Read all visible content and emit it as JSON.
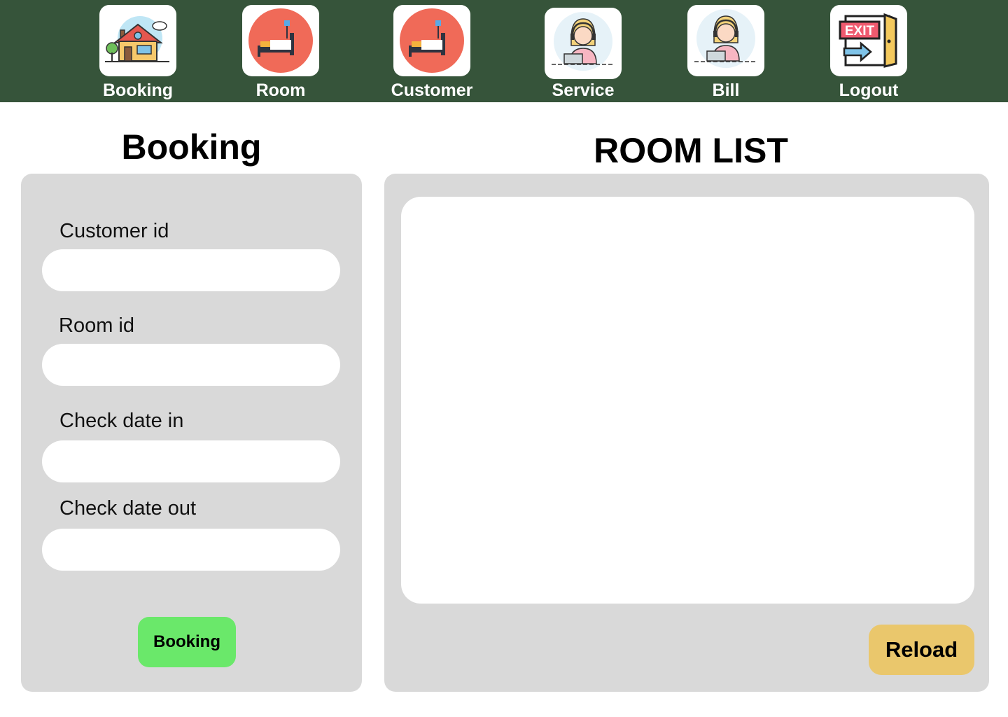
{
  "nav": {
    "items": [
      {
        "label": "Booking",
        "icon": "house-icon"
      },
      {
        "label": "Room",
        "icon": "bed-icon"
      },
      {
        "label": "Customer",
        "icon": "bed-icon"
      },
      {
        "label": "Service",
        "icon": "support-agent-icon"
      },
      {
        "label": "Bill",
        "icon": "support-agent-icon"
      },
      {
        "label": "Logout",
        "icon": "exit-door-icon"
      }
    ],
    "exit_sign_text": "EXIT"
  },
  "booking": {
    "title": "Booking",
    "fields": [
      {
        "label": "Customer id",
        "value": ""
      },
      {
        "label": "Room id",
        "value": ""
      },
      {
        "label": "Check date in",
        "value": ""
      },
      {
        "label": "Check date out",
        "value": ""
      }
    ],
    "submit_label": "Booking"
  },
  "room_list": {
    "title": "ROOM LIST",
    "reload_label": "Reload"
  },
  "colors": {
    "navbar": "#36543a",
    "panel": "#d9d9d9",
    "booking_button": "#6ae86a",
    "reload_button": "#eac76c"
  }
}
